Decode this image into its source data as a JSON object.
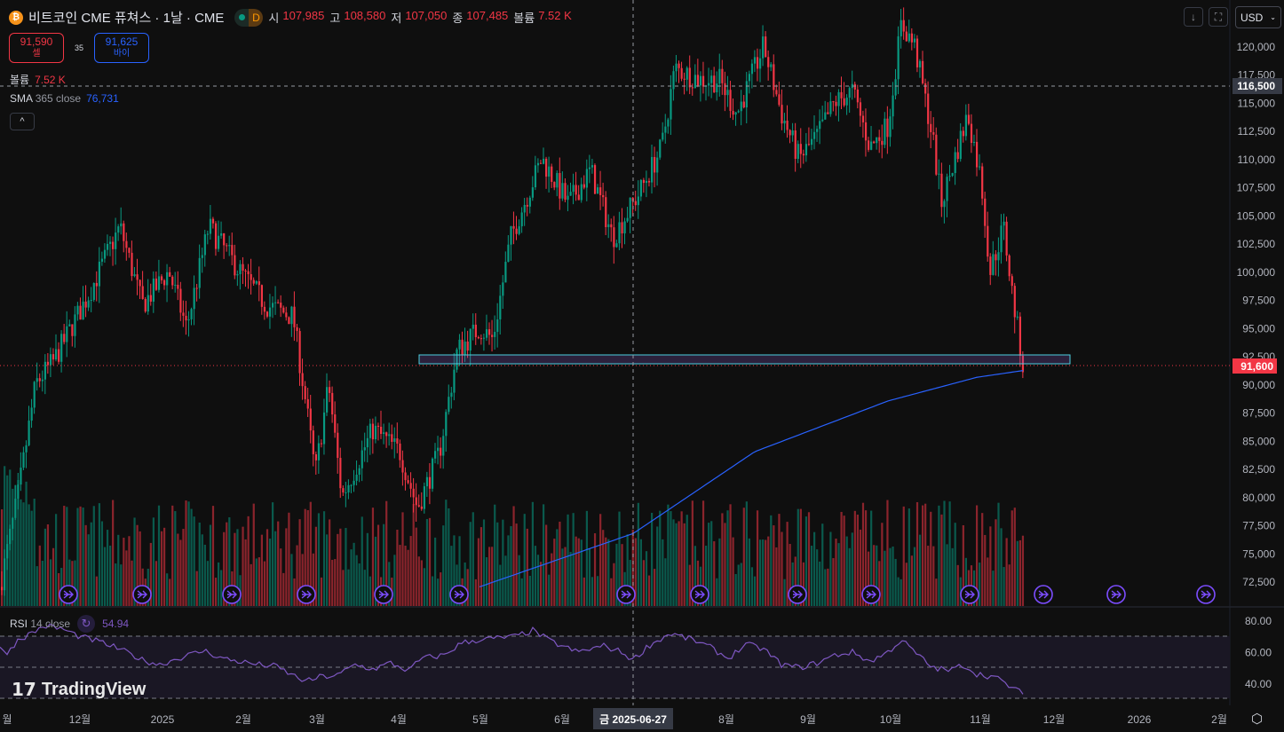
{
  "header": {
    "symbol_icon": "bitcoin-icon",
    "title": "비트코인 CME 퓨쳐스 · 1날 · CME",
    "market_status": "D",
    "ohlc": [
      {
        "k": "시",
        "v": "107,985"
      },
      {
        "k": "고",
        "v": "108,580"
      },
      {
        "k": "저",
        "v": "107,050"
      },
      {
        "k": "종",
        "v": "107,485"
      },
      {
        "k": "볼륨",
        "v": "7.52 K"
      }
    ]
  },
  "trade": {
    "sell_price": "91,590",
    "sell_label": "셀",
    "spread": "35",
    "buy_price": "91,625",
    "buy_label": "바이"
  },
  "indicators": {
    "volume_label": "볼륨",
    "volume_value": "7.52 K",
    "sma_name": "SMA",
    "sma_params": "365 close",
    "sma_value": "76,731",
    "rsi_name": "RSI",
    "rsi_params": "14 close",
    "rsi_value": "54.94"
  },
  "toolbar": {
    "collapse": "^",
    "down": "↓",
    "fullscreen": "⛶",
    "currency": "USD"
  },
  "price_axis": [
    "120,000",
    "117,500",
    "115,000",
    "112,500",
    "110,000",
    "107,500",
    "105,000",
    "102,500",
    "100,000",
    "97,500",
    "95,000",
    "92,500",
    "90,000",
    "87,500",
    "85,000",
    "82,500",
    "80,000",
    "77,500",
    "75,000",
    "72,500"
  ],
  "crosshair": {
    "price": "116,500",
    "date": "금 2025-06-27"
  },
  "last_price": "91,600",
  "rsi_axis": [
    "80.00",
    "60.00",
    "40.00"
  ],
  "time_axis": [
    "월",
    "12월",
    "2025",
    "2월",
    "3월",
    "4월",
    "5월",
    "6월",
    "8월",
    "9월",
    "10월",
    "11월",
    "12월",
    "2026",
    "2월"
  ],
  "logo": "TradingView",
  "colors": {
    "up": "#089981",
    "down": "#f23645",
    "sma": "#2962ff",
    "rsi": "#7e57c2"
  },
  "chart_data": {
    "type": "candlestick",
    "y_range": [
      72500,
      120000
    ],
    "price_path": [
      [
        0,
        72000
      ],
      [
        20,
        80000
      ],
      [
        40,
        90000
      ],
      [
        60,
        92000
      ],
      [
        100,
        98000
      ],
      [
        135,
        104000
      ],
      [
        160,
        97000
      ],
      [
        190,
        100000
      ],
      [
        210,
        95000
      ],
      [
        235,
        104000
      ],
      [
        270,
        100000
      ],
      [
        300,
        97000
      ],
      [
        330,
        96000
      ],
      [
        345,
        88000
      ],
      [
        355,
        82000
      ],
      [
        370,
        90000
      ],
      [
        385,
        80000
      ],
      [
        420,
        86000
      ],
      [
        450,
        84000
      ],
      [
        470,
        79000
      ],
      [
        495,
        84000
      ],
      [
        515,
        93000
      ],
      [
        540,
        95000
      ],
      [
        555,
        94000
      ],
      [
        575,
        103000
      ],
      [
        610,
        110000
      ],
      [
        640,
        106000
      ],
      [
        665,
        109000
      ],
      [
        690,
        103000
      ],
      [
        720,
        107000
      ],
      [
        745,
        111000
      ],
      [
        760,
        118000
      ],
      [
        790,
        117000
      ],
      [
        810,
        117000
      ],
      [
        830,
        114000
      ],
      [
        850,
        118000
      ],
      [
        860,
        120000
      ],
      [
        880,
        114000
      ],
      [
        900,
        110000
      ],
      [
        920,
        112000
      ],
      [
        940,
        115000
      ],
      [
        960,
        116000
      ],
      [
        980,
        111000
      ],
      [
        1000,
        113000
      ],
      [
        1015,
        122000
      ],
      [
        1030,
        120000
      ],
      [
        1050,
        112000
      ],
      [
        1060,
        106000
      ],
      [
        1075,
        110000
      ],
      [
        1090,
        114000
      ],
      [
        1105,
        108000
      ],
      [
        1115,
        100000
      ],
      [
        1130,
        104000
      ],
      [
        1140,
        98000
      ],
      [
        1152,
        91600
      ]
    ],
    "sma_path": [
      [
        540,
        72000
      ],
      [
        713,
        76731
      ],
      [
        850,
        84000
      ],
      [
        1000,
        88500
      ],
      [
        1100,
        90600
      ],
      [
        1152,
        91200
      ]
    ],
    "rsi_path": [
      [
        0,
        62
      ],
      [
        10,
        60
      ],
      [
        20,
        68
      ],
      [
        35,
        72
      ],
      [
        50,
        77
      ],
      [
        70,
        75
      ],
      [
        90,
        70
      ],
      [
        110,
        67
      ],
      [
        130,
        63
      ],
      [
        150,
        58
      ],
      [
        160,
        55
      ],
      [
        180,
        52
      ],
      [
        200,
        56
      ],
      [
        230,
        61
      ],
      [
        250,
        56
      ],
      [
        270,
        54
      ],
      [
        290,
        52
      ],
      [
        310,
        51
      ],
      [
        330,
        45
      ],
      [
        345,
        41
      ],
      [
        360,
        44
      ],
      [
        380,
        45
      ],
      [
        400,
        52
      ],
      [
        420,
        49
      ],
      [
        440,
        53
      ],
      [
        460,
        48
      ],
      [
        475,
        56
      ],
      [
        500,
        58
      ],
      [
        520,
        66
      ],
      [
        540,
        68
      ],
      [
        560,
        69
      ],
      [
        580,
        70
      ],
      [
        600,
        74
      ],
      [
        620,
        67
      ],
      [
        650,
        60
      ],
      [
        680,
        64
      ],
      [
        700,
        60
      ],
      [
        713,
        55
      ],
      [
        730,
        64
      ],
      [
        755,
        72
      ],
      [
        780,
        68
      ],
      [
        800,
        63
      ],
      [
        820,
        56
      ],
      [
        840,
        65
      ],
      [
        860,
        62
      ],
      [
        880,
        52
      ],
      [
        900,
        50
      ],
      [
        920,
        53
      ],
      [
        940,
        58
      ],
      [
        960,
        60
      ],
      [
        980,
        54
      ],
      [
        1000,
        60
      ],
      [
        1015,
        68
      ],
      [
        1030,
        60
      ],
      [
        1050,
        50
      ],
      [
        1070,
        48
      ],
      [
        1085,
        52
      ],
      [
        1100,
        46
      ],
      [
        1120,
        44
      ],
      [
        1140,
        37
      ],
      [
        1152,
        33
      ]
    ],
    "volume_color_rule": "up/down",
    "events_icon": "earnings-arrow-icon"
  }
}
